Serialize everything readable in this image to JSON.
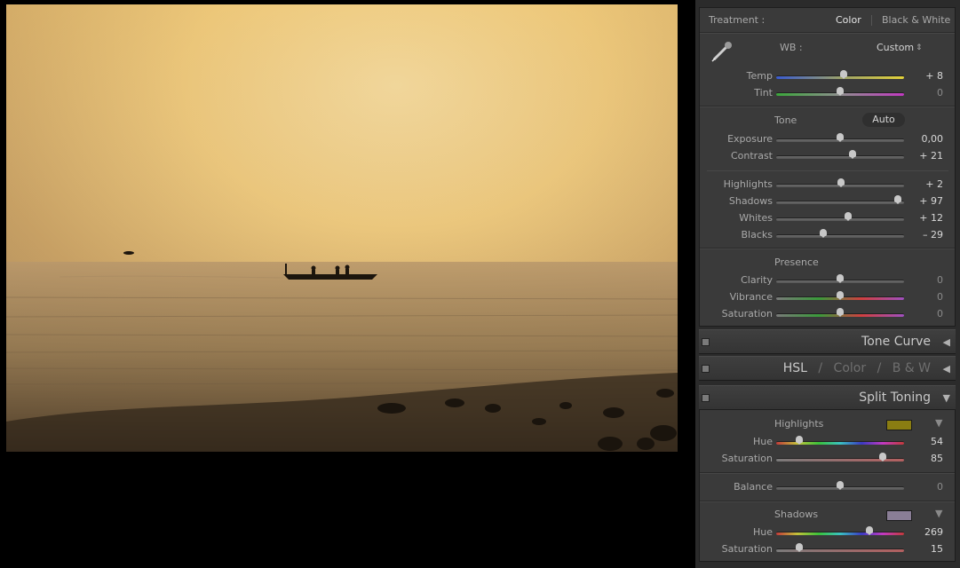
{
  "basic": {
    "treatment_label": "Treatment :",
    "treatment_color": "Color",
    "treatment_bw": "Black & White",
    "wb_label": "WB :",
    "wb_value": "Custom",
    "wb_arrows": "⇕",
    "tone_label": "Tone",
    "auto_label": "Auto",
    "presence_label": "Presence",
    "sliders": [
      {
        "label": "Temp",
        "value": "+ 8",
        "level": 0.53
      },
      {
        "label": "Tint",
        "value": "0",
        "level": 0.5
      },
      {
        "label": "Exposure",
        "value": "0,00",
        "level": 0.5
      },
      {
        "label": "Contrast",
        "value": "+ 21",
        "level": 0.6
      },
      {
        "label": "Highlights",
        "value": "+ 2",
        "level": 0.51
      },
      {
        "label": "Shadows",
        "value": "+ 97",
        "level": 0.95
      },
      {
        "label": "Whites",
        "value": "+ 12",
        "level": 0.56
      },
      {
        "label": "Blacks",
        "value": "– 29",
        "level": 0.37
      },
      {
        "label": "Clarity",
        "value": "0",
        "level": 0.5
      },
      {
        "label": "Vibrance",
        "value": "0",
        "level": 0.5
      },
      {
        "label": "Saturation",
        "value": "0",
        "level": 0.5
      }
    ]
  },
  "panels": {
    "tone_curve": "Tone Curve",
    "hsl": "HSL",
    "hsl_slash1": "/",
    "color": "Color",
    "hsl_slash2": "/",
    "bw": "B & W",
    "split_toning": "Split Toning",
    "collapsed_arrow": "◀",
    "expanded_arrow": "▼"
  },
  "split_toning": {
    "highlights_label": "Highlights",
    "highlights_color": "#8a7d12",
    "shadows_label": "Shadows",
    "shadows_color": "#8a7e96",
    "dropdown_arrow": "▼",
    "sliders": [
      {
        "label": "Hue",
        "value": "54",
        "level": 0.18
      },
      {
        "label": "Saturation",
        "value": "85",
        "level": 0.83
      },
      {
        "label": "Balance",
        "value": "0",
        "level": 0.5
      },
      {
        "label": "Hue",
        "value": "269",
        "level": 0.73
      },
      {
        "label": "Saturation",
        "value": "15",
        "level": 0.18
      }
    ]
  }
}
